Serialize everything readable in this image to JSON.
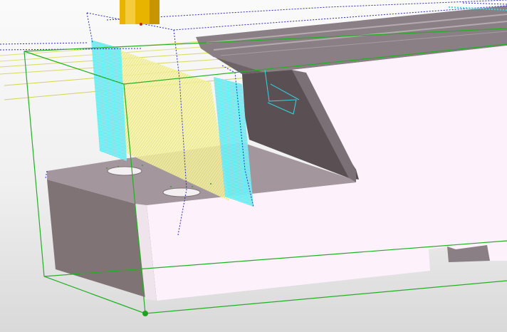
{
  "viewport": {
    "background_top": "#fafafa",
    "background_bottom": "#d9d9d9"
  },
  "colors": {
    "part_face_light": "#fdf1fb",
    "part_face_shadow": "#807375",
    "part_face_mid": "#a0959a",
    "part_face_dark": "#5a5054",
    "bounding_box": "#22b022",
    "wireframe_dashed": "#2a2acc",
    "toolpath_yellow": "#e8e86a",
    "toolpath_cyan": "#30e0e8",
    "tool_holder": "#e8b400",
    "origin_marker": "#1fa31f"
  },
  "scene": {
    "objects": [
      "workpiece",
      "bounding-box",
      "toolpath-yellow",
      "toolpath-cyan",
      "cutting-tool",
      "stock-wireframe",
      "origin-marker"
    ]
  }
}
